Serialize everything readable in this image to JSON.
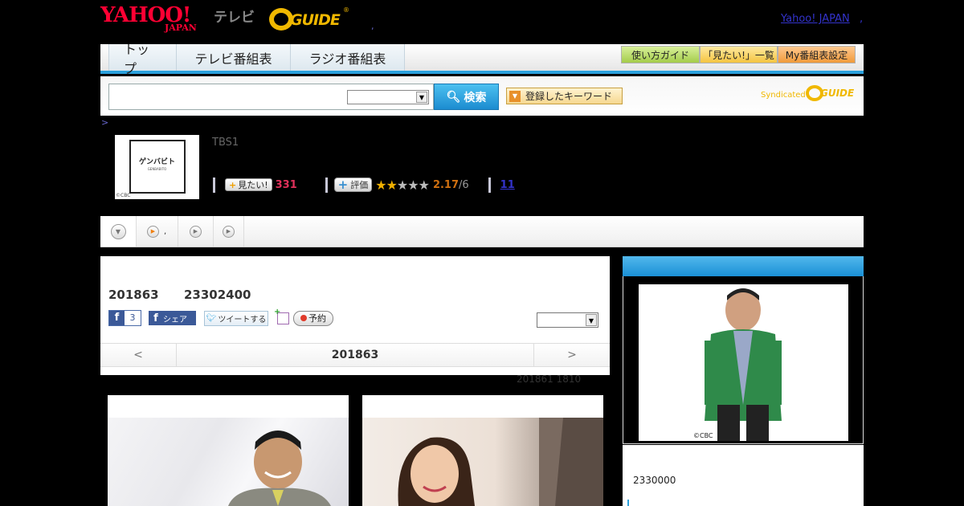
{
  "header": {
    "yahoo_logo_top": "YAHOO!",
    "yahoo_logo_bottom": "JAPAN",
    "tv_label": "テレビ",
    "gguide_logo": "GUIDE",
    "gguide_reg": "®",
    "dot": ",",
    "yahoo_japan_link": "Yahoo! JAPAN",
    "yahoo_japan_dot": ","
  },
  "nav": {
    "tabs": [
      {
        "label": "トップ"
      },
      {
        "label": "テレビ番組表"
      },
      {
        "label": "ラジオ番組表"
      }
    ],
    "buttons": [
      {
        "label": "使い方ガイド",
        "color": "#a4cc4a"
      },
      {
        "label": "「見たい!」一覧",
        "color": "#f4c440"
      },
      {
        "label": "My番組表設定",
        "color": "#f09a3a"
      }
    ]
  },
  "search": {
    "placeholder": "",
    "select_value": "",
    "search_button": "検索",
    "keyword_button": "登録したキーワード",
    "syndicated": "Syndicated",
    "syndicated_logo": "GUIDE"
  },
  "breadcrumb": ">",
  "program": {
    "thumb_title": "ゲンバビト",
    "thumb_subtitle": "GENBABITO",
    "thumb_copyright": "©CBC",
    "channel": "TBS1",
    "mitai_label": "見たい!",
    "mitai_count": "331",
    "hyoka_label": "評価",
    "rating": "2.17",
    "rating_max": "/6",
    "rating_stars": 2,
    "stars_total": 5,
    "review_count": "11"
  },
  "subtabs": [
    {
      "label": ""
    },
    {
      "label": ","
    },
    {
      "label": ""
    },
    {
      "label": ""
    }
  ],
  "episode": {
    "date": "201863",
    "time_code": "23302400",
    "fb_count": "3",
    "fb_share": "シェア",
    "tweet": "ツイートする",
    "reserve": "予約",
    "select_value": "",
    "pager_prev": "<",
    "pager_current": "201863",
    "pager_next": ">",
    "updated": "201861  1810"
  },
  "sidebar": {
    "photo_copyright": "©CBC",
    "value": "2330000"
  },
  "colors": {
    "accent": "#2aa0dc",
    "yahoo_red": "#ff0033",
    "gguide_yellow": "#f0b800",
    "link": "#3333cc"
  }
}
